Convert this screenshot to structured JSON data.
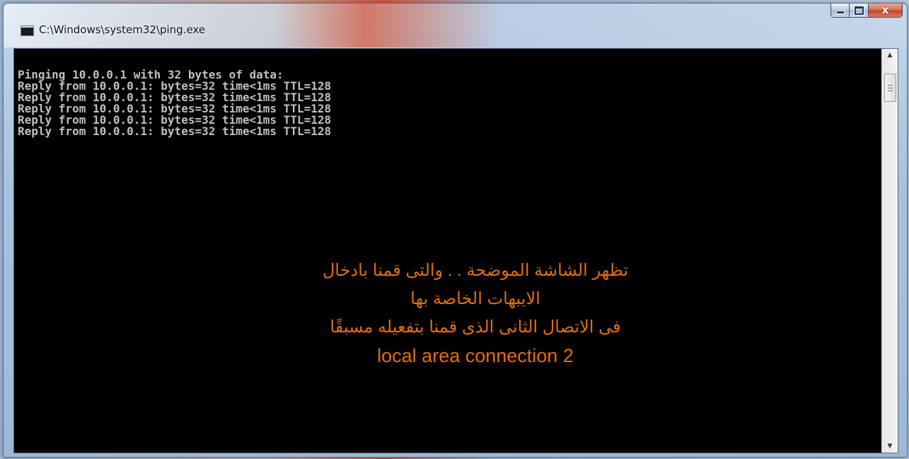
{
  "window": {
    "title": "C:\\Windows\\system32\\ping.exe",
    "icon": "console-app-icon",
    "caption_buttons": {
      "minimize": "minimize-icon",
      "maximize": "maximize-icon",
      "close": "close-icon",
      "close_glyph": "x"
    }
  },
  "console": {
    "lines": [
      "Pinging 10.0.0.1 with 32 bytes of data:",
      "Reply from 10.0.0.1: bytes=32 time<1ms TTL=128",
      "Reply from 10.0.0.1: bytes=32 time<1ms TTL=128",
      "Reply from 10.0.0.1: bytes=32 time<1ms TTL=128",
      "Reply from 10.0.0.1: bytes=32 time<1ms TTL=128",
      "Reply from 10.0.0.1: bytes=32 time<1ms TTL=128"
    ],
    "text_color": "#c0c0c0",
    "background": "#000000"
  },
  "annotation": {
    "color": "#e06d10",
    "lines": [
      "تظهر الشاشة الموضحة . . والتى قمنا بادخال",
      "الايبهات الخاصة بها",
      "فى الاتصال الثانى الذى قمنا بتفعيله مسبقًا",
      "local area connection 2"
    ]
  }
}
